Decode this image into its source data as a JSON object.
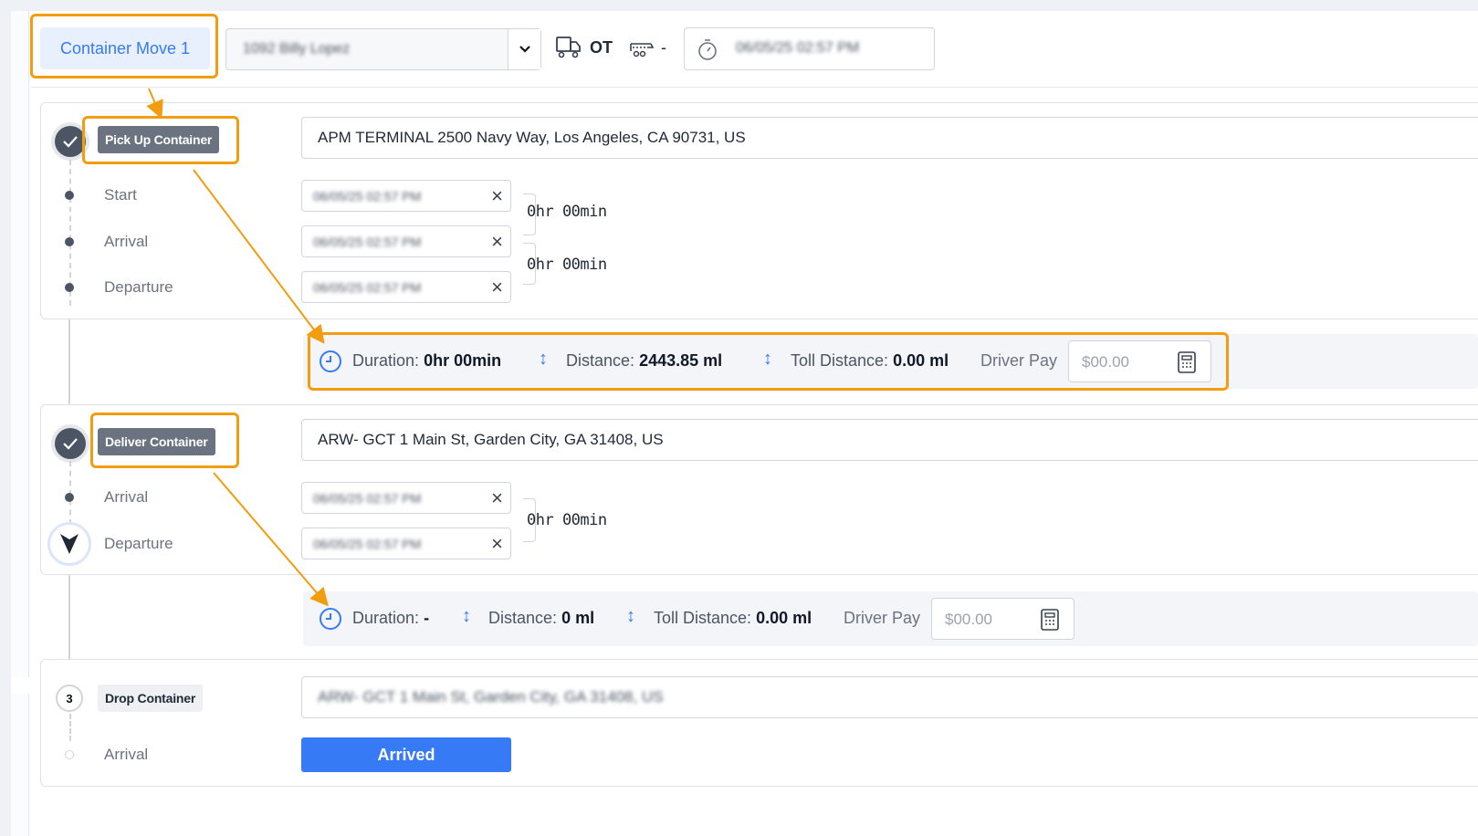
{
  "header": {
    "move_tab_label": "Container Move 1",
    "driver_value": "1092 Billy Lopez",
    "ot_label": "OT",
    "chassis_value": "-",
    "time_value": "06/05/25 02:57 PM"
  },
  "stops": [
    {
      "badge": "Pick Up Container",
      "address": "APM TERMINAL 2500 Navy Way, Los Angeles, CA 90731, US",
      "events": [
        {
          "label": "Start",
          "value": "06/05/25 02:57 PM"
        },
        {
          "label": "Arrival",
          "value": "06/05/25 02:57 PM"
        },
        {
          "label": "Departure",
          "value": "06/05/25 02:57 PM"
        }
      ],
      "durations": [
        "0hr 00min",
        "0hr 00min"
      ],
      "summary": {
        "duration_label": "Duration:",
        "duration_value": "0hr 00min",
        "distance_label": "Distance:",
        "distance_value": "2443.85 ml",
        "toll_label": "Toll Distance:",
        "toll_value": "0.00 ml",
        "pay_label": "Driver Pay",
        "pay_placeholder": "$00.00"
      }
    },
    {
      "badge": "Deliver Container",
      "address": "ARW- GCT 1 Main St, Garden City, GA 31408, US",
      "events": [
        {
          "label": "Arrival",
          "value": "06/05/25 02:57 PM"
        },
        {
          "label": "Departure",
          "value": "06/05/25 02:57 PM"
        }
      ],
      "durations": [
        "0hr 00min"
      ],
      "summary": {
        "duration_label": "Duration:",
        "duration_value": "-",
        "distance_label": "Distance:",
        "distance_value": "0 ml",
        "toll_label": "Toll Distance:",
        "toll_value": "0.00 ml",
        "pay_label": "Driver Pay",
        "pay_placeholder": "$00.00"
      }
    },
    {
      "number": "3",
      "badge": "Drop Container",
      "address": "ARW- GCT 1 Main St, Garden City, GA 31408, US",
      "events": [
        {
          "label": "Arrival"
        }
      ],
      "button_label": "Arrived"
    }
  ],
  "icons": {
    "truck": "truck-icon",
    "chassis": "chassis-icon",
    "stopwatch": "stopwatch-icon",
    "clock": "clock-icon",
    "calculator": "calculator-icon",
    "check": "check-icon",
    "navigation": "navigation-arrow-icon"
  },
  "colors": {
    "accent": "#367bf5",
    "highlight": "#f29d0f",
    "badge": "#6b7280"
  }
}
